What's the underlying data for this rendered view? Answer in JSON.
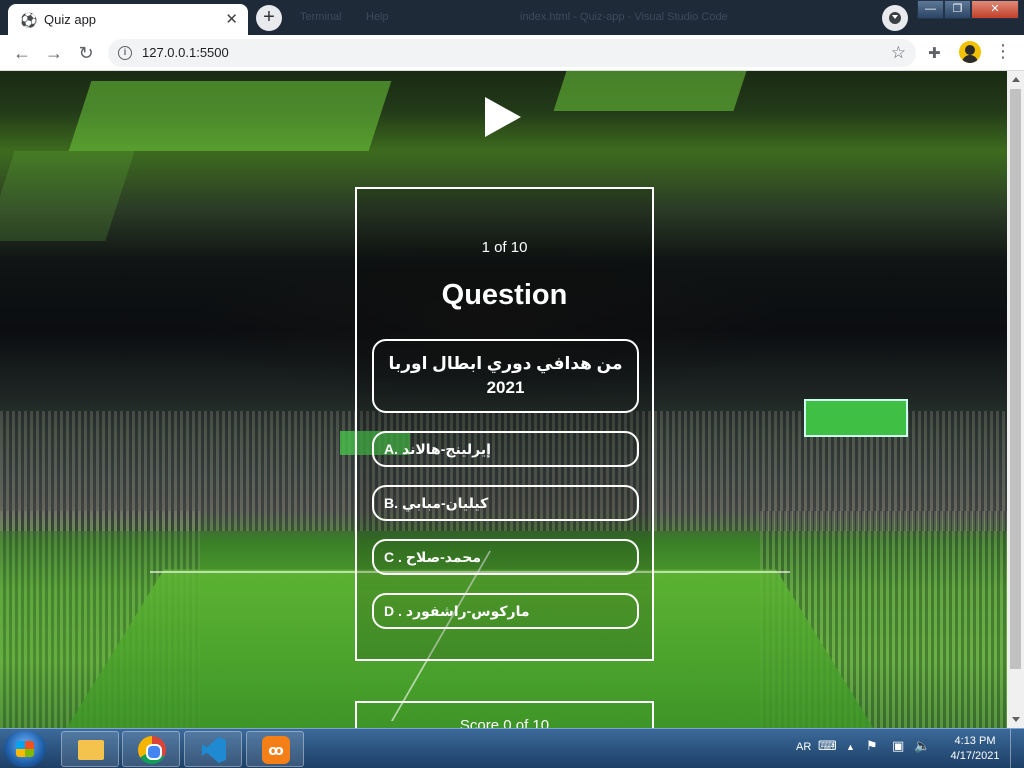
{
  "browser": {
    "tab_title": "Quiz app",
    "url": "127.0.0.1:5500",
    "ghost_items": [
      "Terminal",
      "Help",
      "index.html - Quiz-app - Visual Studio Code"
    ]
  },
  "quiz": {
    "progress": "1 of 10",
    "heading": "Question",
    "question": "من هدافي دوري ابطال اوربا 2021",
    "options": [
      {
        "letter": "A.",
        "text": "إيرلينج-هالاند"
      },
      {
        "letter": "B.",
        "text": "كيليان-مبابي"
      },
      {
        "letter": "C .",
        "text": "محمد-صلاح"
      },
      {
        "letter": "D .",
        "text": "ماركوس-راشفورد"
      }
    ],
    "score": "Score 0 of 10"
  },
  "taskbar": {
    "language": "AR",
    "time": "4:13 PM",
    "date": "4/17/2021"
  }
}
